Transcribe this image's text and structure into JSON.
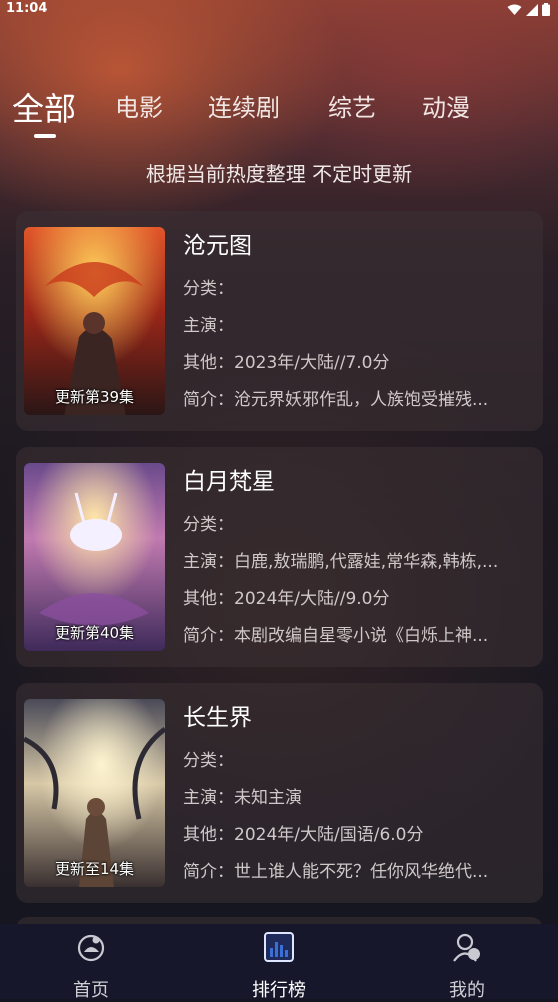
{
  "status_bar": {
    "time": "11:04"
  },
  "tabs": [
    {
      "label": "全部",
      "active": true
    },
    {
      "label": "电影"
    },
    {
      "label": "连续剧"
    },
    {
      "label": "综艺"
    },
    {
      "label": "动漫"
    }
  ],
  "subtitle": "根据当前热度整理 不定时更新",
  "items": [
    {
      "title": "沧元图",
      "episode": "更新第39集",
      "category": "分类：",
      "cast": "主演：",
      "other": "其他：2023年/大陆//7.0分",
      "intro": "简介：沧元界妖邪作乱，人族饱受摧残..."
    },
    {
      "title": "白月梵星",
      "episode": "更新第40集",
      "category": "分类：",
      "cast": "主演：白鹿,敖瑞鹏,代露娃,常华森,韩栋,...",
      "other": "其他：2024年/大陆//9.0分",
      "intro": "简介：本剧改编自星零小说《白烁上神..."
    },
    {
      "title": "长生界",
      "episode": "更新至14集",
      "category": "分类：",
      "cast": "主演：未知主演",
      "other": "其他：2024年/大陆/国语/6.0分",
      "intro": "简介：世上谁人能不死？任你风华绝代..."
    }
  ],
  "nav": [
    {
      "label": "首页",
      "icon": "home-icon"
    },
    {
      "label": "排行榜",
      "icon": "ranking-icon",
      "active": true
    },
    {
      "label": "我的",
      "icon": "profile-icon"
    }
  ],
  "colors": {
    "background": "#151521",
    "nav_background": "#16172a",
    "accent": "#3a6fd8"
  }
}
